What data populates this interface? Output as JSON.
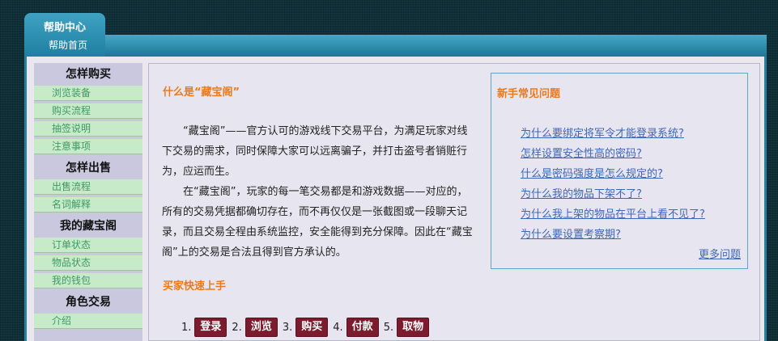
{
  "header": {
    "tab_title": "帮助中心",
    "tab_sub": "帮助首页"
  },
  "sidebar": {
    "sections": [
      {
        "title": "怎样购买",
        "items": [
          "浏览装备",
          "购买流程",
          "抽签说明",
          "注意事项"
        ]
      },
      {
        "title": "怎样出售",
        "items": [
          "出售流程",
          "名词解释"
        ]
      },
      {
        "title": "我的藏宝阁",
        "items": [
          "订单状态",
          "物品状态",
          "我的钱包"
        ]
      },
      {
        "title": "角色交易",
        "items": [
          "介绍"
        ]
      }
    ]
  },
  "main": {
    "what_title": "什么是“藏宝阁”",
    "intro_p1": "“藏宝阁”——官方认可的游戏线下交易平台，为满足玩家对线下交易的需求，同时保障大家可以远离骗子，并打击盗号者销赃行为，应运而生。",
    "intro_p2": "在“藏宝阁”，玩家的每一笔交易都是和游戏数据——对应的，所有的交易凭据都确切存在，而不再仅仅是一张截图或一段聊天记录，而且交易全程由系统监控，安全能得到充分保障。因此在“藏宝阁”上的交易是合法且得到官方承认的。",
    "quick_title": "买家快速上手",
    "steps": [
      {
        "num": "1.",
        "label": "登录"
      },
      {
        "num": "2.",
        "label": "浏览"
      },
      {
        "num": "3.",
        "label": "购买"
      },
      {
        "num": "4.",
        "label": "付款"
      },
      {
        "num": "5.",
        "label": "取物"
      }
    ]
  },
  "faq": {
    "title": "新手常见问题",
    "links": [
      "为什么要绑定将军令才能登录系统?",
      "怎样设置安全性高的密码?",
      "什么是密码强度是怎么规定的?",
      "为什么我的物品下架不了?",
      "为什么我上架的物品在平台上看不见了?",
      "为什么要设置考察期?"
    ],
    "more": "更多问题"
  }
}
